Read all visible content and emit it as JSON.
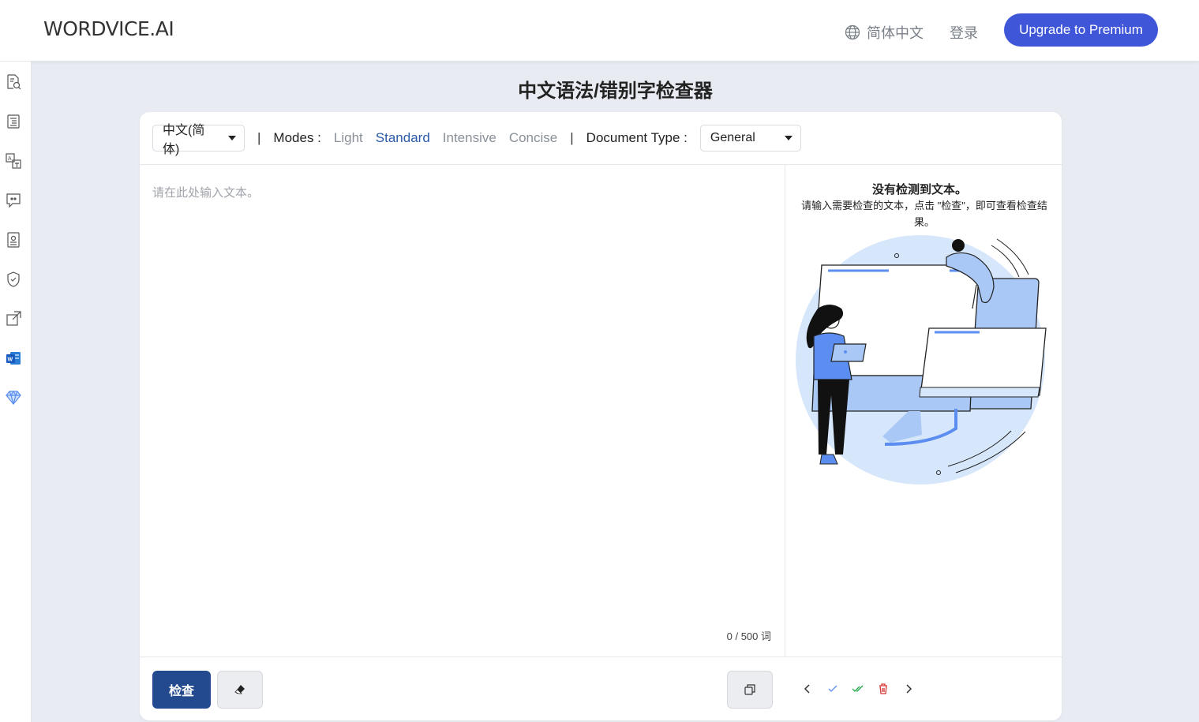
{
  "header": {
    "logo": "WORDVICE.AI",
    "language": "简体中文",
    "login": "登录",
    "upgrade": "Upgrade to Premium"
  },
  "sidebar": {
    "icons": [
      "search-document-icon",
      "document-list-icon",
      "translate-icon",
      "chat-quote-icon",
      "id-card-icon",
      "shield-icon",
      "external-link-icon",
      "word-icon",
      "diamond-icon"
    ]
  },
  "page": {
    "title": "中文语法/错别字检查器"
  },
  "toolbar": {
    "language_select": "中文(简体)",
    "separator": "|",
    "modes_label": "Modes :",
    "modes": [
      "Light",
      "Standard",
      "Intensive",
      "Concise"
    ],
    "active_mode": "Standard",
    "doc_type_label": "Document Type :",
    "doc_type_select": "General"
  },
  "editor": {
    "placeholder": "请在此处输入文本。",
    "counter": "0 / 500 词"
  },
  "result": {
    "title": "没有检测到文本。",
    "description": "请输入需要检查的文本，点击 \"检查\"，即可查看检查结果。"
  },
  "bottom": {
    "check_label": "检查"
  },
  "colors": {
    "accent": "#3f56d8",
    "check_button": "#234a8e",
    "active_mode": "#2a5aa8",
    "illustration_blue": "#a9c8f5",
    "illustration_light": "#d6e6fb",
    "background": "#e8ecf2"
  }
}
